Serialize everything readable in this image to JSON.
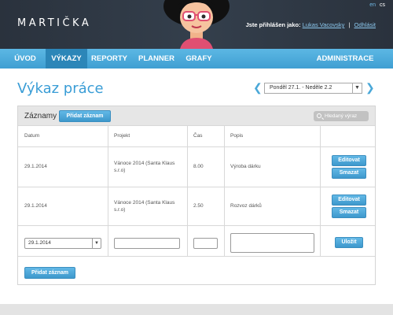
{
  "app": {
    "logo": "MARTIČKA",
    "languages": [
      "en",
      "cs"
    ]
  },
  "user": {
    "prefix": "Jste přihlášen jako:",
    "name": "Lukas Vacovsky",
    "separator": "|",
    "logout": "Odhlásit"
  },
  "nav": {
    "items": [
      "ÚVOD",
      "VÝKAZY",
      "REPORTY",
      "PLANNER",
      "GRAFY"
    ],
    "active": "VÝKAZY",
    "admin": "ADMINISTRACE"
  },
  "page": {
    "title": "Výkaz práce",
    "week_selected": "Ponděl 27.1. - Neděle 2.2"
  },
  "panel": {
    "title": "Záznamy",
    "add_button": "Přidat záznam",
    "search_placeholder": "Hledaný výraz",
    "columns": [
      "Datum",
      "Projekt",
      "Čas",
      "Popis"
    ],
    "rows": [
      {
        "date": "29.1.2014",
        "project": "Vánoce 2014 (Santa Klaus s.r.o)",
        "time": "8.00",
        "description": "Výroba dárku",
        "edit": "Editovat",
        "delete": "Smazat"
      },
      {
        "date": "29.1.2014",
        "project": "Vánoce 2014 (Santa Klaus s.r.o)",
        "time": "2.50",
        "description": "Rozvoz dárků",
        "edit": "Editovat",
        "delete": "Smazat"
      }
    ],
    "new_row": {
      "date_value": "29.1.2014",
      "save": "Uložit"
    },
    "add_button_bottom": "Přidat záznam"
  },
  "colors": {
    "accent": "#4aa8d8",
    "header_bg": "#2b3440",
    "nav_active": "#2c86b8"
  }
}
